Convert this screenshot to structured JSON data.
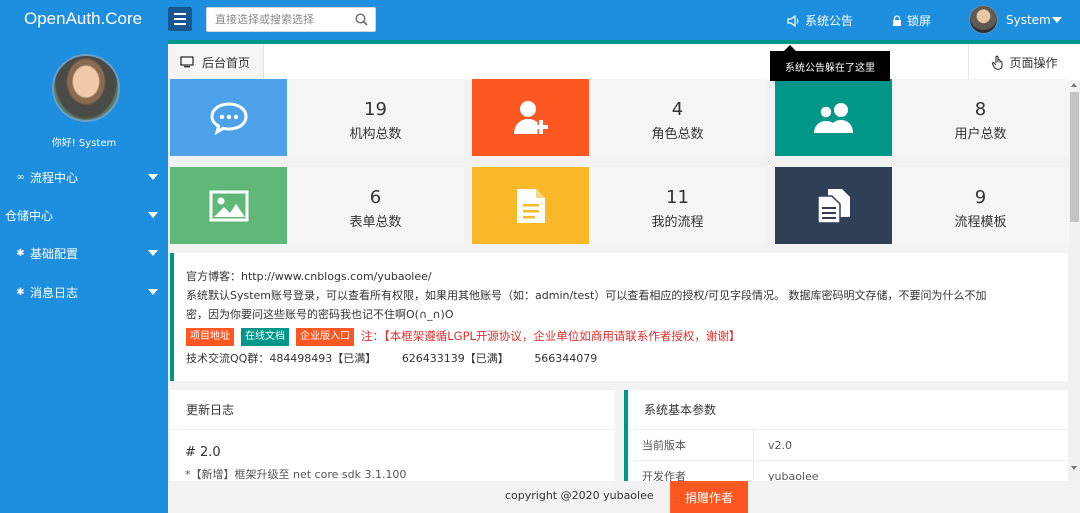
{
  "app": {
    "title": "OpenAuth.Core"
  },
  "header": {
    "search_placeholder": "直接选择或搜索选择",
    "notice_label": "系统公告",
    "lock_label": "锁屏",
    "user_name": "System"
  },
  "sidebar": {
    "greeting": "你好! System",
    "items": [
      {
        "label": "流程中心",
        "icon": "infinity-icon"
      },
      {
        "label": "仓储中心",
        "icon": ""
      },
      {
        "label": "基础配置",
        "icon": "gear-icon"
      },
      {
        "label": "消息日志",
        "icon": "gear-icon"
      }
    ]
  },
  "tabs": {
    "home_label": "后台首页",
    "page_ops_label": "页面操作"
  },
  "tooltip": {
    "text": "系统公告躲在了这里"
  },
  "stats": [
    {
      "value": "19",
      "label": "机构总数",
      "icon": "chat-icon",
      "color": "#4da1e8"
    },
    {
      "value": "4",
      "label": "角色总数",
      "icon": "add-user-icon",
      "color": "#ff5722"
    },
    {
      "value": "8",
      "label": "用户总数",
      "icon": "users-icon",
      "color": "#009688"
    },
    {
      "value": "6",
      "label": "表单总数",
      "icon": "image-icon",
      "color": "#5fb878"
    },
    {
      "value": "11",
      "label": "我的流程",
      "icon": "document-icon",
      "color": "#fbb829"
    },
    {
      "value": "9",
      "label": "流程模板",
      "icon": "copy-icon",
      "color": "#2f4056"
    }
  ],
  "info": {
    "blog": "官方博客：http://www.cnblogs.com/yubaolee/",
    "desc_line1": "系统默认System账号登录，可以查看所有权限，如果用其他账号（如：admin/test）可以查看相应的授权/可见字段情况。 数据库密码明文存储，不要问为什么不加",
    "desc_line2": "密，因为你要问这些账号的密码我也记不住啊O(∩_∩)O",
    "badge_project": "项目地址",
    "badge_docs": "在线文档",
    "badge_enterprise": "企业版入口",
    "license_note": "注：【本框架遵循LGPL开源协议，企业单位如商用请联系作者授权，谢谢】",
    "qq_label": "技术交流QQ群：484498493【已满】",
    "qq_2": "626433139【已满】",
    "qq_3": "566344079"
  },
  "changelog": {
    "title": "更新日志",
    "version_heading": "# 2.0",
    "first_item": "*【新增】框架升级至 net core sdk 3.1.100"
  },
  "sysparams": {
    "title": "系统基本参数",
    "rows": [
      {
        "key": "当前版本",
        "value": "v2.0"
      },
      {
        "key": "开发作者",
        "value": "yubaolee"
      }
    ]
  },
  "footer": {
    "copyright": "copyright @2020 yubaolee",
    "donate_label": "捐赠作者"
  },
  "colors": {
    "primary": "#1e8ede",
    "accent": "#009688",
    "orange": "#ff5722",
    "badge_red": "#ff5722",
    "badge_green": "#009688"
  }
}
